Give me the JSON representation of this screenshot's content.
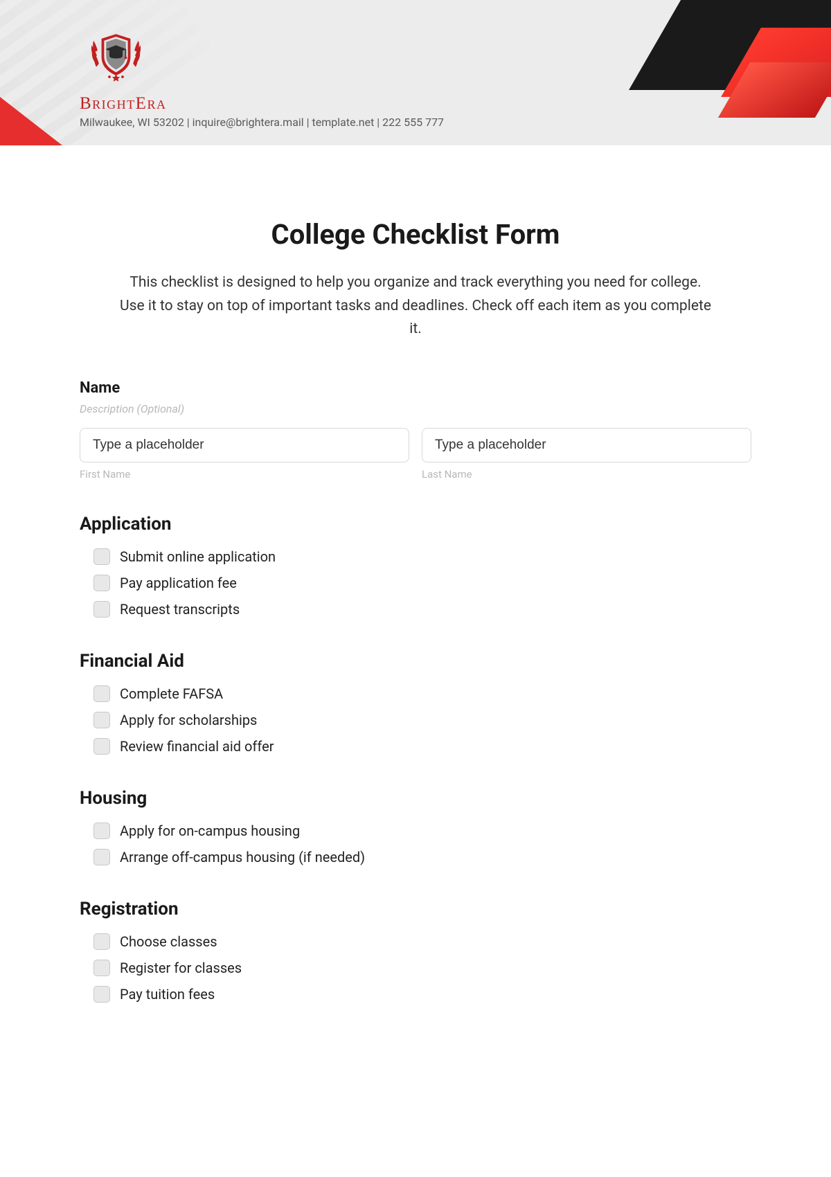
{
  "brand": {
    "name": "BrightEra",
    "contact": "Milwaukee, WI 53202 | inquire@brightera.mail | template.net | 222 555 777"
  },
  "form": {
    "title": "College Checklist Form",
    "intro": "This checklist is designed to help you organize and track everything you need for college. Use it to stay on top of important tasks and deadlines. Check off each item as you complete it."
  },
  "name_field": {
    "label": "Name",
    "description": "Description (Optional)",
    "first": {
      "placeholder": "Type a placeholder",
      "sublabel": "First Name"
    },
    "last": {
      "placeholder": "Type a placeholder",
      "sublabel": "Last Name"
    }
  },
  "sections": [
    {
      "heading": "Application",
      "items": [
        "Submit online application",
        "Pay application fee",
        "Request transcripts"
      ]
    },
    {
      "heading": "Financial Aid",
      "items": [
        "Complete FAFSA",
        "Apply for scholarships",
        "Review financial aid offer"
      ]
    },
    {
      "heading": "Housing",
      "items": [
        "Apply for on-campus housing",
        "Arrange off-campus housing (if needed)"
      ]
    },
    {
      "heading": "Registration",
      "items": [
        "Choose classes",
        "Register for classes",
        "Pay tuition fees"
      ]
    }
  ]
}
